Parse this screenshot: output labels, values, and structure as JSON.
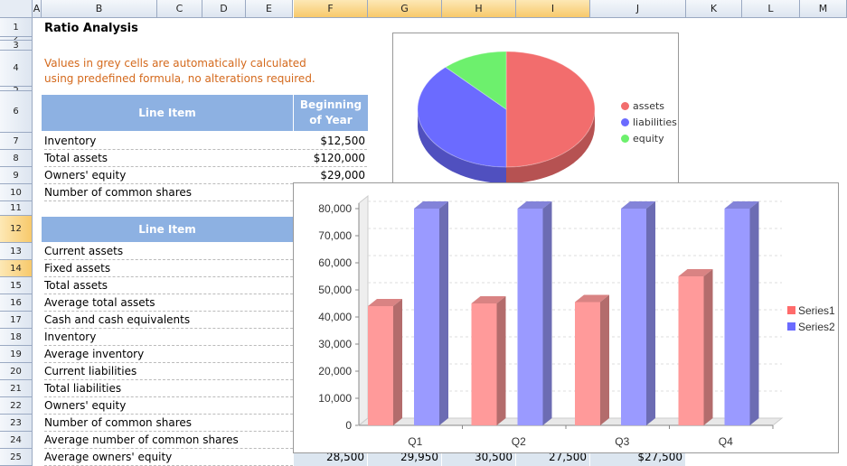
{
  "columns": [
    "A",
    "B",
    "C",
    "D",
    "E",
    "F",
    "G",
    "H",
    "I",
    "J",
    "K",
    "L",
    "M"
  ],
  "rows": [
    "1",
    "2",
    "3",
    "4",
    "5",
    "6",
    "7",
    "8",
    "9",
    "10",
    "11",
    "12",
    "13",
    "14",
    "15",
    "16",
    "17",
    "18",
    "19",
    "20",
    "21",
    "22",
    "23",
    "24",
    "25"
  ],
  "sheet": {
    "title": "Ratio Analysis",
    "note": "Values in grey cells are automatically calculated using predefined formula, no alterations required.",
    "table1": {
      "header_item": "Line Item",
      "header_boy": "Beginning of Year",
      "rows": [
        {
          "label": "Inventory",
          "value": "$12,500"
        },
        {
          "label": "Total assets",
          "value": "$120,000"
        },
        {
          "label": "Owners' equity",
          "value": "$29,000"
        },
        {
          "label": "Number of common shares",
          "value": ""
        }
      ]
    },
    "table2": {
      "header_item": "Line Item",
      "rows": [
        "Current assets",
        "Fixed assets",
        "Total assets",
        "Average total assets",
        "Cash and cash equivalents",
        "Inventory",
        "Average inventory",
        "Current liabilities",
        "Total liabilities",
        "Owners' equity",
        "Number of common shares",
        "Average number of common shares",
        "Average owners' equity"
      ],
      "last_row_values": [
        "28,500",
        "29,950",
        "30,500",
        "27,500",
        "$27,500"
      ]
    }
  },
  "pie_legend": [
    {
      "label": "assets",
      "color": "#f26d6d"
    },
    {
      "label": "liabilities",
      "color": "#6b6bff"
    },
    {
      "label": "equity",
      "color": "#6df06d"
    }
  ],
  "chart_data": [
    {
      "type": "pie",
      "labels": [
        "assets",
        "liabilities",
        "equity"
      ],
      "values": [
        50,
        38,
        12
      ],
      "colors": [
        "#f26d6d",
        "#6b6bff",
        "#6df06d"
      ],
      "legend_position": "right"
    },
    {
      "type": "bar",
      "categories": [
        "Q1",
        "Q2",
        "Q3",
        "Q4"
      ],
      "series": [
        {
          "name": "Series1",
          "values": [
            44000,
            45000,
            45500,
            55000
          ],
          "color": "#ff9a9a"
        },
        {
          "name": "Series2",
          "values": [
            80000,
            80000,
            80000,
            80000
          ],
          "color": "#9a9aff"
        }
      ],
      "ylim": [
        0,
        80000
      ],
      "yticks": [
        "0",
        "10,000",
        "20,000",
        "30,000",
        "40,000",
        "50,000",
        "60,000",
        "70,000",
        "80,000"
      ],
      "grid": true,
      "legend_position": "right"
    }
  ]
}
